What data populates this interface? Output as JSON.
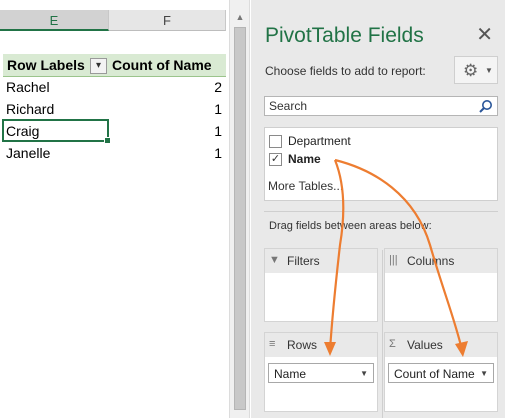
{
  "sheet": {
    "columns": [
      "E",
      "F"
    ],
    "pivot_header": {
      "row_labels": "Row Labels",
      "count_label": "Count of Name",
      "filter_icon": "sort-filter-icon"
    },
    "rows": [
      {
        "name": "Rachel",
        "count": "2"
      },
      {
        "name": "Richard",
        "count": "1"
      },
      {
        "name": "Craig",
        "count": "1"
      },
      {
        "name": "Janelle",
        "count": "1"
      }
    ]
  },
  "pane": {
    "title": "PivotTable Fields",
    "subtitle": "Choose fields to add to report:",
    "search_placeholder": "Search",
    "fields": [
      {
        "label": "Department",
        "checked": false
      },
      {
        "label": "Name",
        "checked": true
      }
    ],
    "more_tables": "More Tables...",
    "drag_hint": "Drag fields between areas below:",
    "areas": {
      "filters": {
        "label": "Filters",
        "icon": "filter-icon"
      },
      "columns": {
        "label": "Columns",
        "icon": "columns-icon"
      },
      "rows": {
        "label": "Rows",
        "icon": "rows-icon",
        "chip": "Name"
      },
      "values": {
        "label": "Values",
        "icon": "sigma-icon",
        "chip": "Count of Name"
      }
    },
    "close_icon": "close-icon",
    "gear_icon": "gear-icon"
  },
  "colors": {
    "accent": "#217346",
    "header_fill": "#d9ead3",
    "arrow": "#ed7d31"
  }
}
